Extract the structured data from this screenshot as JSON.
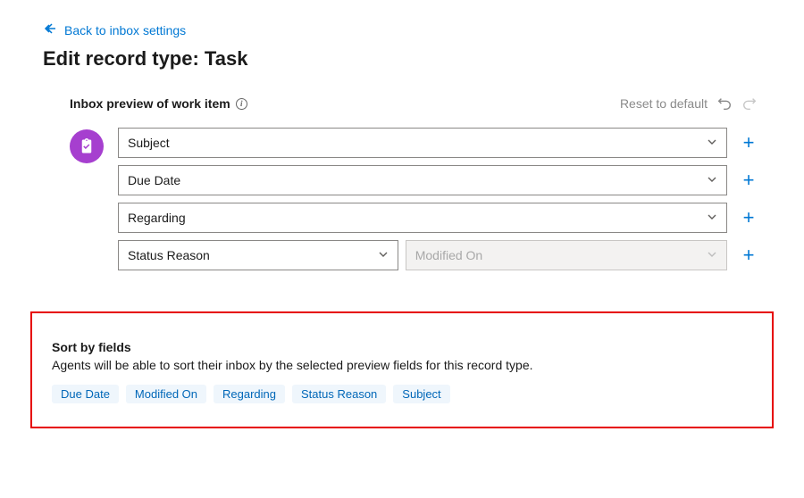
{
  "back_link": "Back to inbox settings",
  "page_title": "Edit record type: Task",
  "preview": {
    "title": "Inbox preview of work item",
    "reset_label": "Reset to default"
  },
  "fields": {
    "row1": "Subject",
    "row2": "Due Date",
    "row3": "Regarding",
    "row4a": "Status Reason",
    "row4b": "Modified On"
  },
  "sort": {
    "title": "Sort by fields",
    "description": "Agents will be able to sort their inbox by the selected preview fields for this record type.",
    "chips": [
      "Due Date",
      "Modified On",
      "Regarding",
      "Status Reason",
      "Subject"
    ]
  }
}
